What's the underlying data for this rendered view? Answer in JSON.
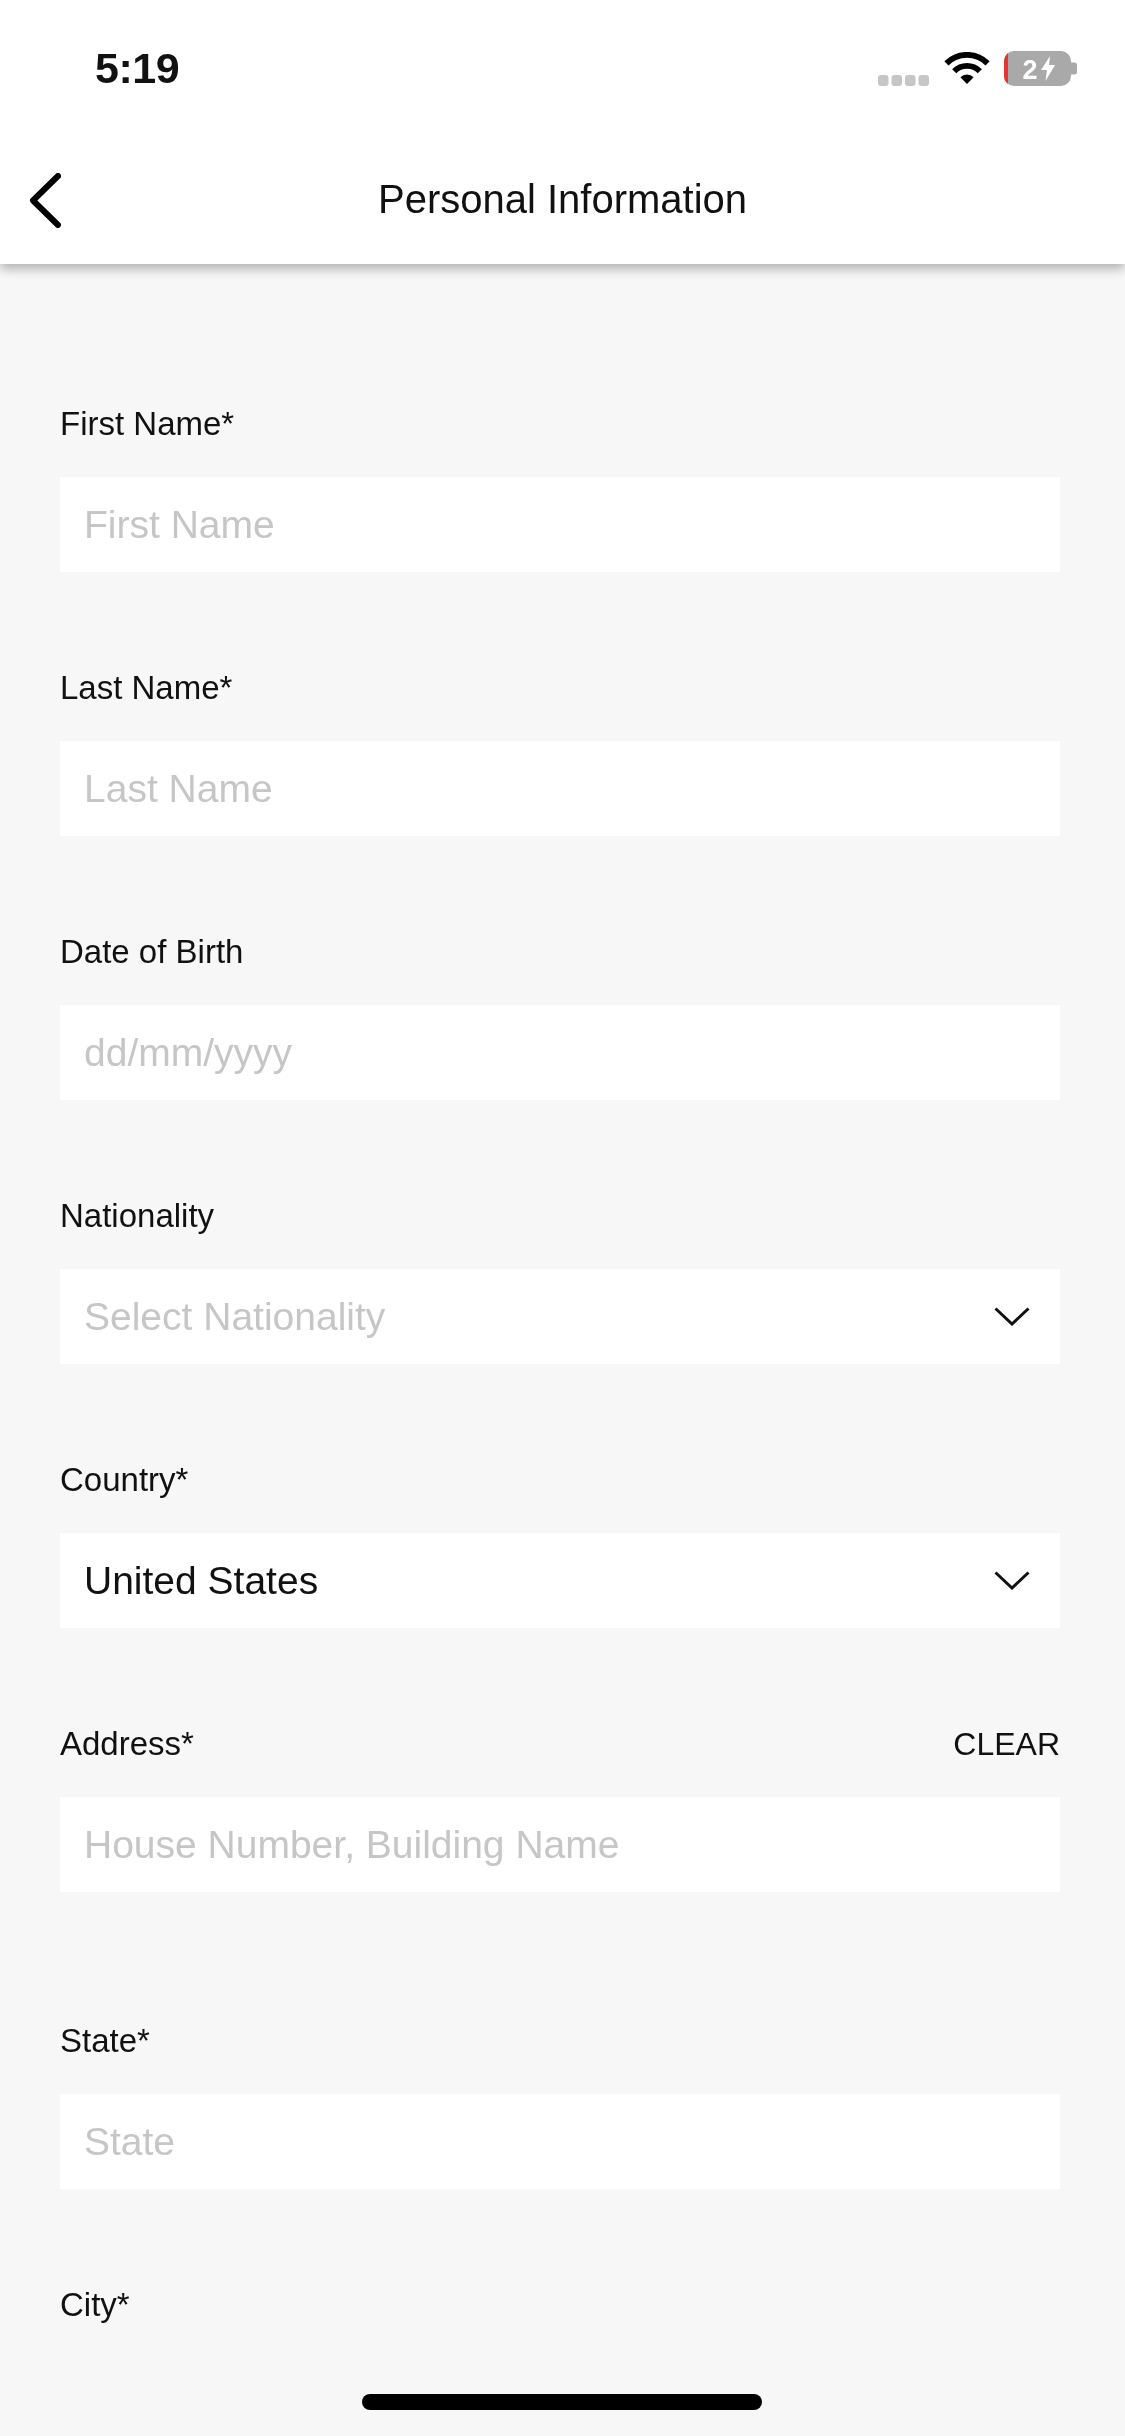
{
  "status_bar": {
    "time": "5:19",
    "battery_text": "2",
    "charging": true
  },
  "header": {
    "title": "Personal Information"
  },
  "form": {
    "fields": [
      {
        "kind": "text",
        "label": "First Name*",
        "placeholder": "First Name"
      },
      {
        "kind": "text",
        "label": "Last Name*",
        "placeholder": "Last Name"
      },
      {
        "kind": "text",
        "label": "Date of Birth",
        "placeholder": "dd/mm/yyyy"
      },
      {
        "kind": "select",
        "label": "Nationality",
        "placeholder": "Select Nationality"
      },
      {
        "kind": "select",
        "label": "Country*",
        "value": "United States"
      },
      {
        "kind": "text",
        "label": "Address*",
        "action": "CLEAR",
        "placeholder": "House Number, Building Name"
      },
      {
        "kind": "text",
        "label": "State*",
        "placeholder": "State"
      },
      {
        "kind": "label",
        "label": "City*"
      }
    ]
  }
}
